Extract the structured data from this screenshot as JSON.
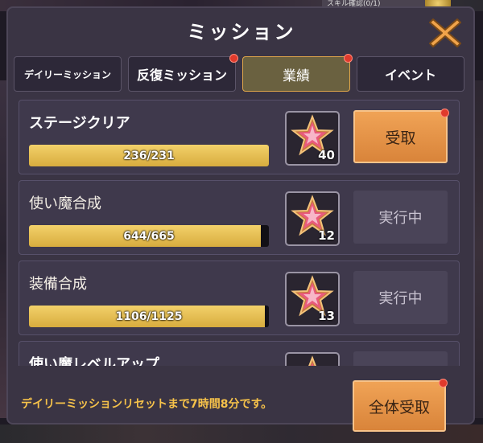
{
  "background": {
    "top_right_text": "スキル確認(0/1)"
  },
  "header": {
    "title": "ミッション"
  },
  "tabs": [
    {
      "label": "デイリーミッション",
      "active": false,
      "badge": false
    },
    {
      "label": "反復ミッション",
      "active": false,
      "badge": true
    },
    {
      "label": "業績",
      "active": true,
      "badge": true
    },
    {
      "label": "イベント",
      "active": false,
      "badge": false
    }
  ],
  "missions": [
    {
      "title": "ステージクリア",
      "progress": "236/231",
      "fill": 1.0,
      "reward_icon": "pink-star-icon",
      "reward_count": "40",
      "button": "受取",
      "claimable": true
    },
    {
      "title": "使い魔合成",
      "progress": "644/665",
      "fill": 0.968,
      "reward_icon": "pink-star-icon",
      "reward_count": "12",
      "button": "実行中",
      "claimable": false
    },
    {
      "title": "装備合成",
      "progress": "1106/1125",
      "fill": 0.983,
      "reward_icon": "pink-star-icon",
      "reward_count": "13",
      "button": "実行中",
      "claimable": false
    },
    {
      "title": "使い魔レベルアップ",
      "progress": "",
      "fill": 0,
      "reward_icon": "pink-star-icon",
      "reward_count": "",
      "button": "",
      "claimable": false
    }
  ],
  "footer": {
    "reset_notice": "デイリーミッションリセットまで7時間8分です。",
    "claim_all_label": "全体受取"
  },
  "colors": {
    "panel": "#3a3444",
    "accent_orange": "#e8944a",
    "progress_gold": "#e8c050",
    "notice_yellow": "#f6c24a",
    "badge_red": "#e03a2c"
  }
}
